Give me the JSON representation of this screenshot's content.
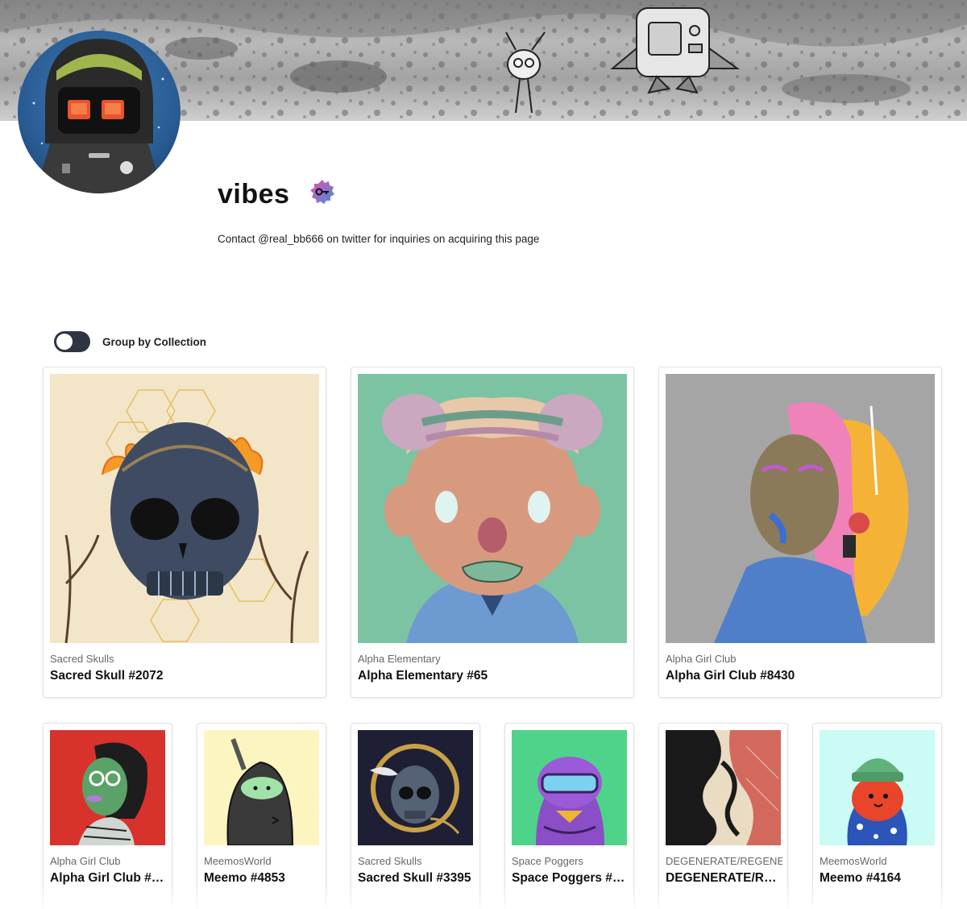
{
  "profile": {
    "name": "vibes",
    "bio": "Contact @real_bb666 on twitter for inquiries on acquiring this page",
    "badge_icon": "verified-key-icon"
  },
  "controls": {
    "group_toggle_label": "Group by Collection",
    "group_toggle_on": false
  },
  "featured": [
    {
      "collection": "Sacred Skulls",
      "title": "Sacred Skull #2072"
    },
    {
      "collection": "Alpha Elementary",
      "title": "Alpha Elementary #65"
    },
    {
      "collection": "Alpha Girl Club",
      "title": "Alpha Girl Club #8430"
    }
  ],
  "items": [
    {
      "collection": "Alpha Girl Club",
      "title": "Alpha Girl Club #8..."
    },
    {
      "collection": "MeemosWorld",
      "title": "Meemo #4853"
    },
    {
      "collection": "Sacred Skulls",
      "title": "Sacred Skull #3395"
    },
    {
      "collection": "Space Poggers",
      "title": "Space Poggers #1..."
    },
    {
      "collection": "DEGENERATE/REGENERATE",
      "title": "DEGENERATE/RE..."
    },
    {
      "collection": "MeemosWorld",
      "title": "Meemo #4164"
    }
  ],
  "colors": {
    "toggle_bg": "#2f3442",
    "badge_pink": "#e84fa3",
    "badge_blue": "#3f8ee6"
  }
}
